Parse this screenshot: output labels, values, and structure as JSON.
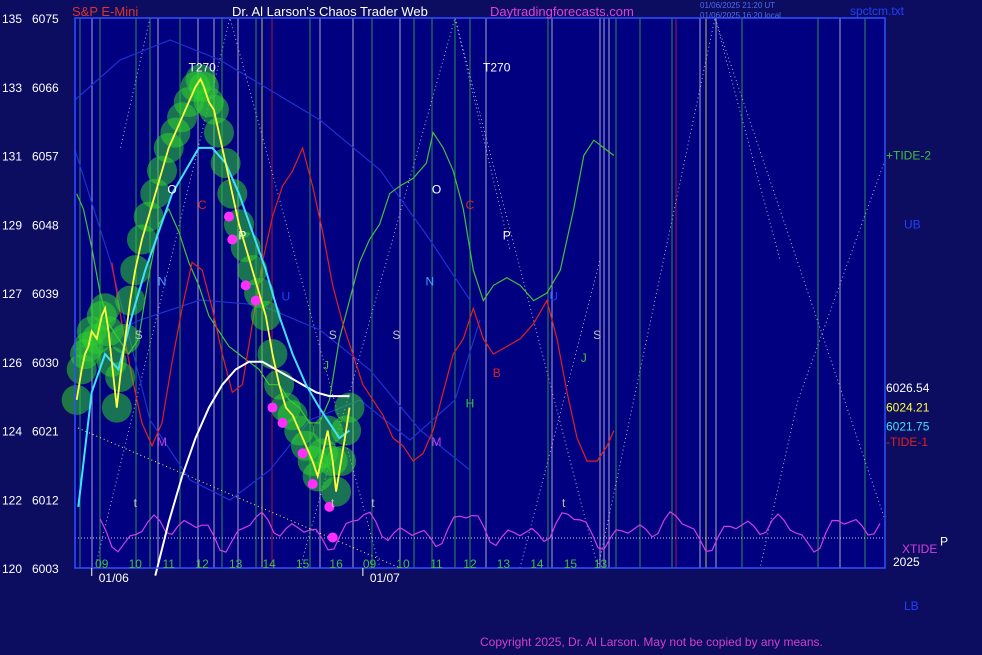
{
  "header": {
    "symbol": "S&P E-Mini",
    "author": "Dr. Al Larson's Chaos Trader Web",
    "site": "Daytradingforecasts.com",
    "timestamp_1": "01/06/2025 21:20 UT",
    "timestamp_2": "01/06/2025 16:20 local",
    "filename": "spctcm.txt"
  },
  "copyright": "Copyright 2025, Dr. Al Larson. May not be copied by any means.",
  "colors": {
    "background": "#0c0c60",
    "plot_background": "#000080",
    "price": "#ffff40",
    "ema_fast": "#40e0ff",
    "ema_slow": "#ffffff",
    "tide_plus": "#40c040",
    "tide_minus": "#e02020",
    "xtide": "#d040e0",
    "bands": "#2030d0",
    "halo": "#30d030",
    "magenta_dots": "#ff30ff"
  },
  "chart_data": {
    "type": "line",
    "title": "S&P E-Mini",
    "ylim": [
      6003,
      6075
    ],
    "y_ticks": [
      {
        "left": "135",
        "right": "6075",
        "v": 6075
      },
      {
        "left": "133",
        "right": "6066",
        "v": 6066
      },
      {
        "left": "131",
        "right": "6057",
        "v": 6057
      },
      {
        "left": "129",
        "right": "6048",
        "v": 6048
      },
      {
        "left": "127",
        "right": "6039",
        "v": 6039
      },
      {
        "left": "126",
        "right": "6030",
        "v": 6030
      },
      {
        "left": "124",
        "right": "6021",
        "v": 6021
      },
      {
        "left": "122",
        "right": "6012",
        "v": 6012
      },
      {
        "left": "120",
        "right": "6003",
        "v": 6003
      }
    ],
    "xlim": [
      8.7,
      32.9
    ],
    "x_hour_ticks": [
      {
        "label": "09",
        "h": 9.5
      },
      {
        "label": "10",
        "h": 10.5
      },
      {
        "label": "11",
        "h": 11.5
      },
      {
        "label": "12",
        "h": 12.5
      },
      {
        "label": "13",
        "h": 13.5
      },
      {
        "label": "14",
        "h": 14.5
      },
      {
        "label": "15",
        "h": 15.5
      },
      {
        "label": "16",
        "h": 16.5
      },
      {
        "label": "09",
        "h": 17.5
      },
      {
        "label": "10",
        "h": 18.5
      },
      {
        "label": "11",
        "h": 19.5
      },
      {
        "label": "12",
        "h": 20.5
      },
      {
        "label": "13",
        "h": 21.5
      },
      {
        "label": "14",
        "h": 22.5
      },
      {
        "label": "15",
        "h": 23.5
      },
      {
        "label": "13",
        "h": 24.4
      }
    ],
    "x_dates": [
      {
        "label": "01/06",
        "h": 9.2
      },
      {
        "label": "01/07",
        "h": 17.3
      }
    ],
    "year_label": "2025",
    "price": [
      [
        8.75,
        6025
      ],
      [
        8.9,
        6029
      ],
      [
        9.0,
        6031
      ],
      [
        9.1,
        6032
      ],
      [
        9.2,
        6034
      ],
      [
        9.35,
        6033
      ],
      [
        9.5,
        6036
      ],
      [
        9.6,
        6037
      ],
      [
        9.7,
        6034
      ],
      [
        9.8,
        6030
      ],
      [
        9.95,
        6024
      ],
      [
        10.05,
        6028
      ],
      [
        10.2,
        6033
      ],
      [
        10.35,
        6038
      ],
      [
        10.5,
        6042
      ],
      [
        10.7,
        6046
      ],
      [
        10.9,
        6049
      ],
      [
        11.1,
        6052
      ],
      [
        11.3,
        6055
      ],
      [
        11.5,
        6058
      ],
      [
        11.7,
        6060
      ],
      [
        11.9,
        6062
      ],
      [
        12.1,
        6064
      ],
      [
        12.3,
        6066
      ],
      [
        12.45,
        6067
      ],
      [
        12.55,
        6066
      ],
      [
        12.7,
        6064
      ],
      [
        12.85,
        6063
      ],
      [
        13.0,
        6060
      ],
      [
        13.2,
        6056
      ],
      [
        13.4,
        6052
      ],
      [
        13.6,
        6048
      ],
      [
        13.8,
        6045
      ],
      [
        14.0,
        6042
      ],
      [
        14.2,
        6039
      ],
      [
        14.4,
        6036
      ],
      [
        14.6,
        6031
      ],
      [
        14.8,
        6027
      ],
      [
        15.0,
        6024
      ],
      [
        15.2,
        6023
      ],
      [
        15.4,
        6021
      ],
      [
        15.6,
        6019
      ],
      [
        15.8,
        6017
      ],
      [
        15.95,
        6015
      ],
      [
        16.1,
        6018
      ],
      [
        16.25,
        6021
      ],
      [
        16.4,
        6017
      ],
      [
        16.5,
        6013
      ],
      [
        16.65,
        6017
      ],
      [
        16.8,
        6021
      ],
      [
        16.9,
        6024
      ]
    ],
    "ema_fast": [
      [
        8.8,
        6011
      ],
      [
        9.2,
        6026
      ],
      [
        9.6,
        6031
      ],
      [
        10.0,
        6029
      ],
      [
        10.4,
        6036
      ],
      [
        10.8,
        6042
      ],
      [
        11.2,
        6047
      ],
      [
        11.6,
        6052
      ],
      [
        12.0,
        6055
      ],
      [
        12.4,
        6058
      ],
      [
        12.8,
        6058
      ],
      [
        13.2,
        6056
      ],
      [
        13.6,
        6052
      ],
      [
        14.0,
        6047
      ],
      [
        14.4,
        6042
      ],
      [
        14.8,
        6036
      ],
      [
        15.2,
        6031
      ],
      [
        15.6,
        6027
      ],
      [
        16.0,
        6024
      ],
      [
        16.3,
        6022
      ],
      [
        16.6,
        6020
      ],
      [
        16.9,
        6021
      ]
    ],
    "ema_slow": [
      [
        11.1,
        6002
      ],
      [
        11.5,
        6009
      ],
      [
        11.9,
        6015
      ],
      [
        12.3,
        6020
      ],
      [
        12.7,
        6024
      ],
      [
        13.1,
        6027
      ],
      [
        13.5,
        6029
      ],
      [
        13.9,
        6030
      ],
      [
        14.3,
        6030
      ],
      [
        14.7,
        6029
      ],
      [
        15.1,
        6028
      ],
      [
        15.5,
        6027
      ],
      [
        15.9,
        6026
      ],
      [
        16.3,
        6025.5
      ],
      [
        16.9,
        6025.5
      ]
    ],
    "tide_plus": [
      [
        8.75,
        6052
      ],
      [
        8.95,
        6050
      ],
      [
        9.2,
        6045
      ],
      [
        9.45,
        6039
      ],
      [
        9.7,
        6035
      ],
      [
        10.0,
        6033
      ],
      [
        10.3,
        6031
      ],
      [
        10.6,
        6033
      ],
      [
        10.9,
        6041
      ],
      [
        11.2,
        6048
      ],
      [
        11.5,
        6050
      ],
      [
        11.8,
        6047
      ],
      [
        12.1,
        6043
      ],
      [
        12.4,
        6040
      ],
      [
        12.7,
        6036
      ],
      [
        13.0,
        6034
      ],
      [
        13.3,
        6032
      ],
      [
        13.6,
        6031
      ],
      [
        13.9,
        6030
      ],
      [
        14.2,
        6029
      ],
      [
        14.5,
        6027
      ],
      [
        14.8,
        6027
      ],
      [
        15.1,
        6025
      ],
      [
        15.4,
        6024
      ],
      [
        15.7,
        6022
      ],
      [
        16.0,
        6022
      ],
      [
        16.3,
        6025
      ],
      [
        16.6,
        6033
      ],
      [
        16.9,
        6038
      ],
      [
        17.2,
        6043
      ],
      [
        17.5,
        6046
      ],
      [
        17.8,
        6048
      ],
      [
        18.1,
        6052
      ],
      [
        18.4,
        6053
      ],
      [
        18.8,
        6054
      ],
      [
        19.2,
        6056
      ],
      [
        19.4,
        6060
      ],
      [
        19.7,
        6058
      ],
      [
        20.0,
        6055
      ],
      [
        20.3,
        6050
      ],
      [
        20.6,
        6042
      ],
      [
        20.9,
        6038
      ],
      [
        21.2,
        6040
      ],
      [
        21.6,
        6041
      ],
      [
        22.0,
        6040
      ],
      [
        22.4,
        6038
      ],
      [
        22.8,
        6039
      ],
      [
        23.2,
        6042
      ],
      [
        23.6,
        6050
      ],
      [
        23.9,
        6057
      ],
      [
        24.2,
        6059
      ],
      [
        24.5,
        6058
      ],
      [
        24.8,
        6057
      ]
    ],
    "tide_minus": [
      [
        9.8,
        6043
      ],
      [
        10.1,
        6035
      ],
      [
        10.4,
        6028
      ],
      [
        10.7,
        6022
      ],
      [
        11.0,
        6019
      ],
      [
        11.3,
        6022
      ],
      [
        11.6,
        6030
      ],
      [
        11.9,
        6037
      ],
      [
        12.2,
        6043
      ],
      [
        12.5,
        6042
      ],
      [
        12.8,
        6037
      ],
      [
        13.1,
        6031
      ],
      [
        13.4,
        6026
      ],
      [
        13.7,
        6027
      ],
      [
        14.0,
        6035
      ],
      [
        14.3,
        6043
      ],
      [
        14.6,
        6049
      ],
      [
        14.9,
        6053
      ],
      [
        15.2,
        6055
      ],
      [
        15.5,
        6058
      ],
      [
        15.8,
        6053
      ],
      [
        16.1,
        6047
      ],
      [
        16.4,
        6040
      ],
      [
        16.7,
        6035
      ],
      [
        17.0,
        6031
      ],
      [
        17.3,
        6027
      ],
      [
        17.6,
        6025
      ],
      [
        17.9,
        6023
      ],
      [
        18.2,
        6020
      ],
      [
        18.5,
        6019
      ],
      [
        18.8,
        6017
      ],
      [
        19.1,
        6018
      ],
      [
        19.4,
        6021
      ],
      [
        19.7,
        6026
      ],
      [
        20.0,
        6031
      ],
      [
        20.3,
        6033
      ],
      [
        20.6,
        6037
      ],
      [
        20.9,
        6033
      ],
      [
        21.2,
        6031
      ],
      [
        21.6,
        6032
      ],
      [
        22.0,
        6033
      ],
      [
        22.4,
        6035
      ],
      [
        22.8,
        6038
      ],
      [
        23.1,
        6033
      ],
      [
        23.4,
        6026
      ],
      [
        23.7,
        6020
      ],
      [
        24.0,
        6017
      ],
      [
        24.3,
        6017
      ],
      [
        24.6,
        6019
      ],
      [
        24.8,
        6021
      ]
    ]
  },
  "cycle_letters": [
    {
      "t": "O",
      "c": "#ffffff",
      "h": 11.6,
      "v": 6052
    },
    {
      "t": "N",
      "c": "#40a0ff",
      "h": 11.3,
      "v": 6040
    },
    {
      "t": "S",
      "c": "#c0c0c0",
      "h": 10.6,
      "v": 6033
    },
    {
      "t": "M",
      "c": "#c040e0",
      "h": 11.3,
      "v": 6019
    },
    {
      "t": "C",
      "c": "#e02020",
      "h": 12.5,
      "v": 6050
    },
    {
      "t": "P",
      "c": "#ffffff",
      "h": 13.7,
      "v": 6046
    },
    {
      "t": "U",
      "c": "#2040ff",
      "h": 15.0,
      "v": 6038
    },
    {
      "t": "J",
      "c": "#40c040",
      "h": 16.2,
      "v": 6029
    },
    {
      "t": "S",
      "c": "#c0c0c0",
      "h": 16.4,
      "v": 6033
    },
    {
      "t": "S",
      "c": "#c0c0c0",
      "h": 18.3,
      "v": 6033
    },
    {
      "t": "O",
      "c": "#ffffff",
      "h": 19.5,
      "v": 6052
    },
    {
      "t": "N",
      "c": "#40a0ff",
      "h": 19.3,
      "v": 6040
    },
    {
      "t": "M",
      "c": "#c040e0",
      "h": 19.5,
      "v": 6019
    },
    {
      "t": "C",
      "c": "#e02020",
      "h": 20.5,
      "v": 6050
    },
    {
      "t": "P",
      "c": "#ffffff",
      "h": 21.6,
      "v": 6046
    },
    {
      "t": "H",
      "c": "#40c040",
      "h": 20.5,
      "v": 6024
    },
    {
      "t": "B",
      "c": "#e02020",
      "h": 21.3,
      "v": 6028
    },
    {
      "t": "U",
      "c": "#2040ff",
      "h": 23.0,
      "v": 6038
    },
    {
      "t": "S",
      "c": "#c0c0c0",
      "h": 24.3,
      "v": 6033
    },
    {
      "t": "J",
      "c": "#40c040",
      "h": 23.9,
      "v": 6030
    },
    {
      "t": "t",
      "c": "#c0c0c0",
      "h": 10.5,
      "v": 6011
    },
    {
      "t": "t",
      "c": "#c0c0c0",
      "h": 16.4,
      "v": 6011
    },
    {
      "t": "t",
      "c": "#c0c0c0",
      "h": 17.6,
      "v": 6011
    },
    {
      "t": "t",
      "c": "#c0c0c0",
      "h": 23.3,
      "v": 6011
    }
  ],
  "t270_labels": [
    {
      "t": "T270",
      "h": 12.5,
      "v": 6068
    },
    {
      "t": "T270",
      "h": 21.3,
      "v": 6068
    }
  ],
  "right_labels": [
    {
      "t": "+TIDE-2",
      "c": "#40c040",
      "v": 6057
    },
    {
      "t": "UB",
      "c": "#2040ff",
      "v": 6048
    },
    {
      "t": "6026.54",
      "c": "#ffffff",
      "v": 6026.54
    },
    {
      "t": "6024.21",
      "c": "#ffff40",
      "v": 6024.0
    },
    {
      "t": "6021.75",
      "c": "#40e0ff",
      "v": 6021.5
    },
    {
      "t": "-TIDE-1",
      "c": "#e02020",
      "v": 6019.5
    },
    {
      "t": "XTIDE",
      "c": "#d040e0",
      "v": 6005.5
    },
    {
      "t": "LB",
      "c": "#2040ff",
      "v": 5998
    },
    {
      "t": "P",
      "c": "#ffffff",
      "v": 6006.5
    }
  ]
}
